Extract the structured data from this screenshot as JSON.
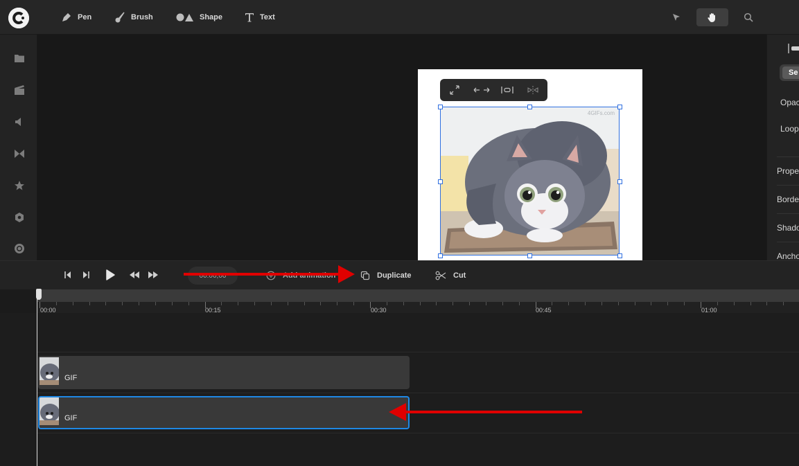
{
  "toolbar": {
    "tools": [
      {
        "label": "Pen",
        "icon": "pen-icon"
      },
      {
        "label": "Brush",
        "icon": "brush-icon"
      },
      {
        "label": "Shape",
        "icon": "shape-icon"
      },
      {
        "label": "Text",
        "icon": "text-icon"
      }
    ],
    "right_tools": [
      "select-arrow-icon",
      "hand-icon",
      "search-icon"
    ],
    "active_tool": "hand-icon"
  },
  "sidebar": {
    "icons": [
      "folder-icon",
      "media-icon",
      "audio-icon",
      "transition-icon",
      "star-icon",
      "hexagon-icon",
      "record-icon"
    ]
  },
  "canvas": {
    "float_toolbar_icons": [
      "expand-icon",
      "flip-horizontal-icon",
      "align-center-icon",
      "mirror-icon"
    ],
    "watermark": "4GIFs.com"
  },
  "right_panel": {
    "tab_label": "Se",
    "opacity_label": "Opac",
    "loop_label": "Loop",
    "sections": [
      "Prope",
      "Borde",
      "Shado",
      "Ancho"
    ]
  },
  "controls": {
    "time": "00:00,00",
    "add_animation": "Add animation",
    "duplicate": "Duplicate",
    "cut": "Cut"
  },
  "timeline": {
    "ticks": [
      "00:00",
      "00:15",
      "00:30",
      "00:45",
      "01:00"
    ],
    "clips": [
      {
        "label": "GIF",
        "selected": false
      },
      {
        "label": "GIF",
        "selected": true
      }
    ]
  },
  "colors": {
    "accent": "#1e88e5",
    "selection": "#2f6fe0",
    "annotation_arrow": "#e00000"
  }
}
